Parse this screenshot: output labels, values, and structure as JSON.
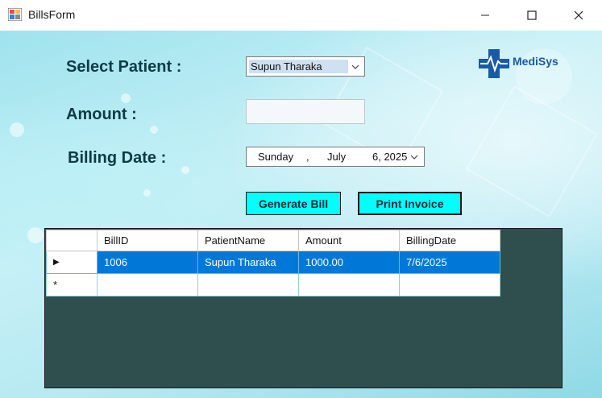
{
  "window": {
    "title": "BillsForm"
  },
  "form": {
    "select_patient_label": "Select Patient :",
    "amount_label": "Amount :",
    "billing_date_label": "Billing Date :",
    "patient_value": "Supun Tharaka",
    "amount_value": "",
    "date": {
      "weekday": "Sunday",
      "sep": ",",
      "month": "July",
      "day_year": "6, 2025"
    }
  },
  "buttons": {
    "generate": "Generate Bill",
    "print": "Print Invoice"
  },
  "logo": {
    "text": "MediSys"
  },
  "grid": {
    "columns": [
      "BillID",
      "PatientName",
      "Amount",
      "BillingDate"
    ],
    "rows": [
      [
        "1006",
        "Supun Tharaka",
        "1000.00",
        "7/6/2025"
      ]
    ],
    "new_row_marker": "*",
    "current_row_marker": "▶"
  },
  "colors": {
    "button": "#00ffff",
    "selection": "#0078d7",
    "grid_background": "#2f4f4f"
  }
}
